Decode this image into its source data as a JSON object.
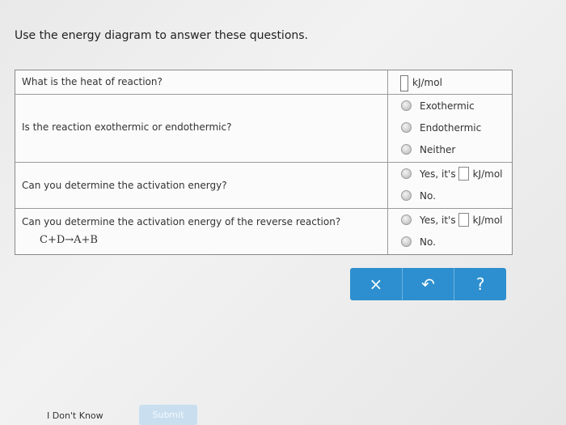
{
  "instruction": "Use the energy diagram to answer these questions.",
  "questions": {
    "q1": {
      "text": "What is the heat of reaction?",
      "unit": "kJ/mol"
    },
    "q2": {
      "text": "Is the reaction exothermic or endothermic?",
      "options": [
        "Exothermic",
        "Endothermic",
        "Neither"
      ]
    },
    "q3": {
      "text": "Can you determine the activation energy?",
      "yes_label": "Yes, it's",
      "unit": "kJ/mol",
      "no_label": "No."
    },
    "q4": {
      "text": "Can you determine the activation energy of the reverse reaction?",
      "equation": "C+D→A+B",
      "yes_label": "Yes, it's",
      "unit": "kJ/mol",
      "no_label": "No."
    }
  },
  "toolbar": {
    "clear_label": "×",
    "undo_label": "↶",
    "help_label": "?"
  },
  "footer": {
    "dont_know": "I Don't Know",
    "submit": "Submit"
  },
  "colors": {
    "toolbar_blue": "#2d8fcf",
    "submit_disabled": "#c9dff0"
  }
}
